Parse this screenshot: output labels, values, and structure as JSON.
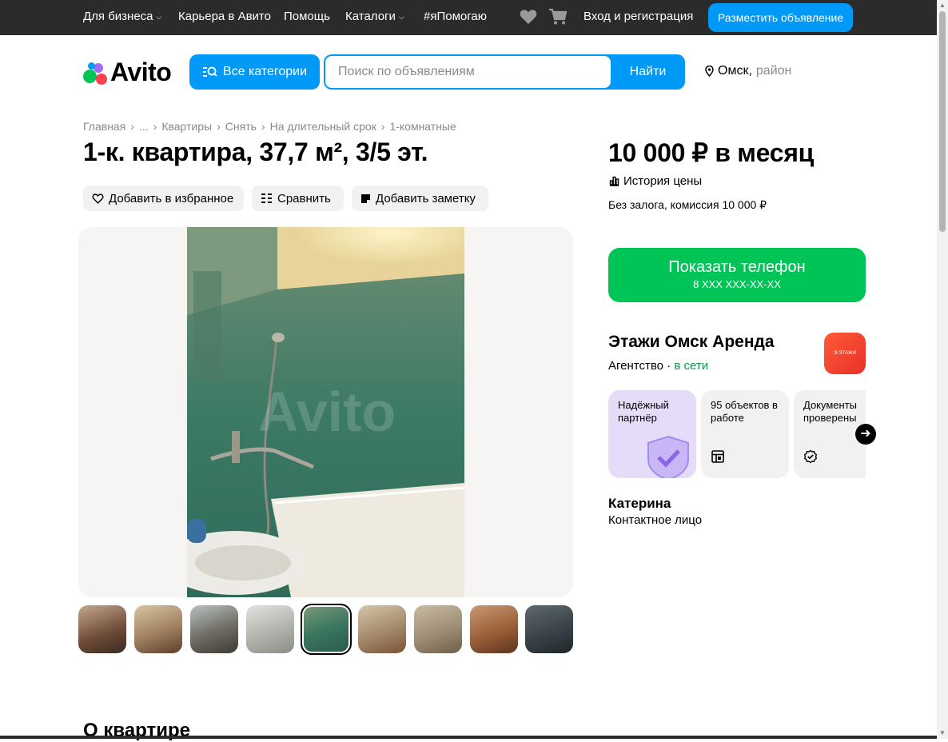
{
  "topbar": {
    "nav": [
      {
        "label": "Для бизнеса",
        "dropdown": true
      },
      {
        "label": "Карьера в Авито",
        "dropdown": false
      },
      {
        "label": "Помощь",
        "dropdown": false
      },
      {
        "label": "Каталоги",
        "dropdown": true
      },
      {
        "label": "#яПомогаю",
        "dropdown": false
      }
    ],
    "login_label": "Вход и регистрация",
    "post_label": "Разместить объявление"
  },
  "header": {
    "logo_text": "Avito",
    "categories_label": "Все категории",
    "search_placeholder": "Поиск по объявлениям",
    "search_button": "Найти",
    "city": "Омск,",
    "district": "район"
  },
  "breadcrumbs": [
    "Главная",
    "...",
    "Квартиры",
    "Снять",
    "На длительный срок",
    "1-комнатные"
  ],
  "listing": {
    "title": "1-к. квартира, 37,7 м², 3/5 эт.",
    "actions": {
      "favorite": "Добавить в избранное",
      "compare": "Сравнить",
      "note": "Добавить заметку"
    },
    "watermark": "Avito",
    "thumbnails_count": 9,
    "active_thumbnail": 5,
    "about_heading": "О квартире"
  },
  "sidebar": {
    "price": "10 000 ₽ в месяц",
    "price_history": "История цены",
    "deposit": "Без залога, комиссия 10 000 ₽",
    "phone_button": "Показать телефон",
    "phone_mask": "8 XXX XXX-XX-XX",
    "seller_name": "Этажи Омск Аренда",
    "seller_type": "Агентство",
    "seller_status": "в сети",
    "seller_avatar_text": "Э ЭТАЖИ",
    "badges": [
      {
        "label": "Надёжный партнёр",
        "icon": "shield-check-icon"
      },
      {
        "label": "95 объектов в работе",
        "icon": "layout-icon"
      },
      {
        "label": "Документы проверены",
        "icon": "verified-icon"
      }
    ],
    "contact_name": "Катерина",
    "contact_role": "Контактное лицо"
  },
  "colors": {
    "accent": "#0099f7",
    "phone_button": "#00c455",
    "topbar": "#2b2b2b",
    "online": "#00a046",
    "partner_card": "#e5dcfa"
  }
}
